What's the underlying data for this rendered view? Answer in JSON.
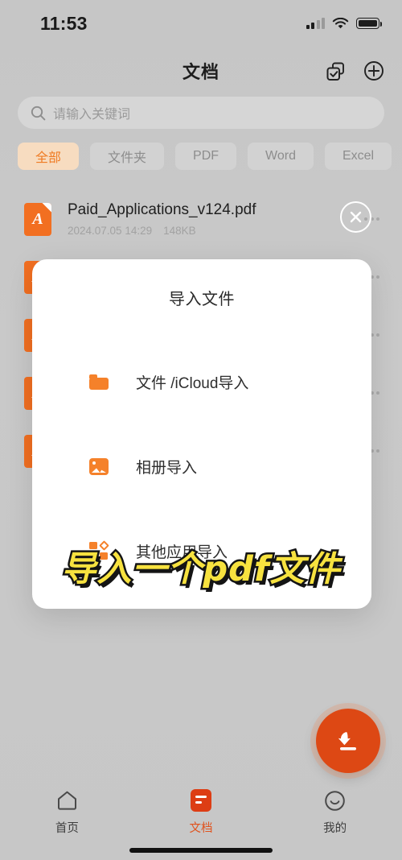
{
  "status_bar": {
    "time": "11:53",
    "signal_icon": "cellular-signal-icon",
    "wifi_icon": "wifi-icon",
    "battery_icon": "battery-icon"
  },
  "header": {
    "title": "文档",
    "select_icon": "multi-select-icon",
    "add_icon": "plus-circle-icon"
  },
  "search": {
    "placeholder": "请输入关键词",
    "icon": "search-icon"
  },
  "filters": {
    "items": [
      {
        "label": "全部",
        "active": true
      },
      {
        "label": "文件夹",
        "active": false
      },
      {
        "label": "PDF",
        "active": false
      },
      {
        "label": "Word",
        "active": false
      },
      {
        "label": "Excel",
        "active": false
      },
      {
        "label": "",
        "active": false
      }
    ],
    "active_color": "#ef7b23",
    "active_bg": "#f7dcc0"
  },
  "file_list": {
    "rows": [
      {
        "name": "Paid_Applications_v124.pdf",
        "date": "2024.07.05 14:29",
        "size": "148KB",
        "icon": "pdf-file-icon"
      },
      {
        "name": "",
        "date": "",
        "size": "",
        "icon": "pdf-file-icon"
      },
      {
        "name": "",
        "date": "",
        "size": "",
        "icon": "pdf-file-icon"
      },
      {
        "name": "",
        "date": "",
        "size": "",
        "icon": "pdf-file-icon"
      },
      {
        "name": "",
        "date": "",
        "size": "",
        "icon": "pdf-file-icon"
      },
      {
        "name": "",
        "date": "",
        "size": "",
        "icon": "pdf-file-icon"
      }
    ],
    "more_icon": "more-dots-icon"
  },
  "close_button": {
    "icon": "close-x-icon"
  },
  "modal": {
    "title": "导入文件",
    "options": [
      {
        "label": "文件 /iCloud导入",
        "icon": "folder-icon"
      },
      {
        "label": "相册导入",
        "icon": "photo-library-icon"
      },
      {
        "label": "其他应用导入",
        "icon": "other-apps-icon"
      }
    ],
    "accent_color": "#f5812a"
  },
  "fab": {
    "icon": "import-download-icon",
    "color": "#dd4814"
  },
  "caption": {
    "text": "导入一个pdf文件",
    "fill": "#f7e23f",
    "stroke": "#141414"
  },
  "tab_bar": {
    "items": [
      {
        "label": "首页",
        "icon": "home-icon",
        "active": false
      },
      {
        "label": "文档",
        "icon": "document-icon",
        "active": true
      },
      {
        "label": "我的",
        "icon": "profile-smiley-icon",
        "active": false
      }
    ],
    "active_color": "#e0521d"
  }
}
